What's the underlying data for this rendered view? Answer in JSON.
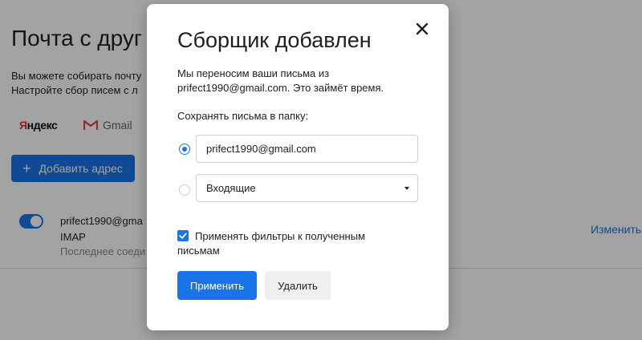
{
  "background": {
    "title": "Почта с друг",
    "description_line1": "Вы можете собирать почту",
    "description_line2": "Настройте сбор писем с л",
    "providers": [
      {
        "name": "Яндекс",
        "icon": "yandex-logo"
      },
      {
        "name": "Gmail",
        "icon": "gmail-icon"
      }
    ],
    "add_button_icon": "+",
    "add_button_label": "Добавить адрес",
    "account": {
      "email": "prifect1990@gma",
      "protocol": "IMAP",
      "last_sync": "Последнее соеди",
      "enabled": true
    },
    "edit_link": "Изменить"
  },
  "modal": {
    "title": "Сборщик добавлен",
    "message": "Мы переносим ваши письма из prifect1990@gmail.com. Это займёт время.",
    "folder_label": "Сохранять письма в папку:",
    "options": [
      {
        "label": "prifect1990@gmail.com",
        "selected": true
      },
      {
        "label": "Входящие",
        "selected": false
      }
    ],
    "apply_filters_label": "Применять фильтры к полученным письмам",
    "apply_filters_checked": true,
    "apply_button": "Применить",
    "delete_button": "Удалить",
    "close_icon": "close-icon"
  },
  "colors": {
    "accent": "#1a73e8",
    "overlay": "rgba(0,0,0,0.36)",
    "secondary_button": "#efefef"
  }
}
